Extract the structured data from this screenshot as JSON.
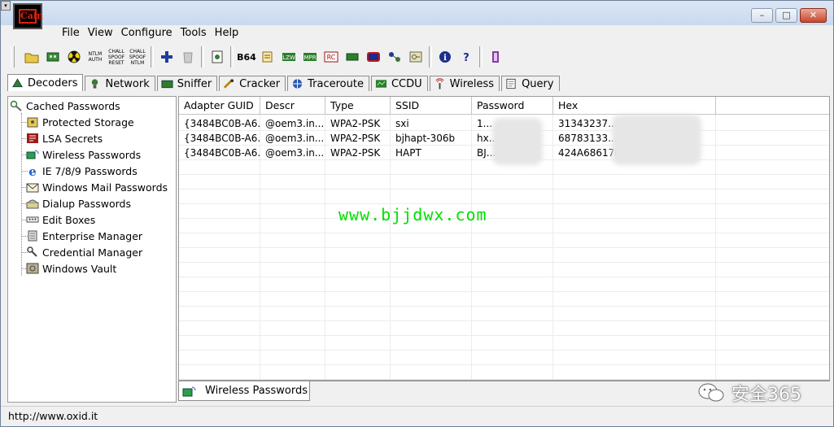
{
  "window": {
    "app_icon_text": "Cain",
    "buttons": {
      "minimize": "–",
      "maximize": "□",
      "close": "✕"
    }
  },
  "menu": [
    "File",
    "View",
    "Configure",
    "Tools",
    "Help"
  ],
  "toolbar": {
    "ntlm_auth": "NTLM AUTH",
    "chall_spoof_reset": "CHALL SPOOF RESET",
    "chall_spoof_ntlm": "CHALL SPOOF NTLM",
    "b64": "B64"
  },
  "tabs": [
    "Decoders",
    "Network",
    "Sniffer",
    "Cracker",
    "Traceroute",
    "CCDU",
    "Wireless",
    "Query"
  ],
  "tree": {
    "root": "Cached Passwords",
    "items": [
      "Protected Storage",
      "LSA Secrets",
      "Wireless Passwords",
      "IE 7/8/9 Passwords",
      "Windows Mail Passwords",
      "Dialup Passwords",
      "Edit Boxes",
      "Enterprise Manager",
      "Credential Manager",
      "Windows Vault"
    ]
  },
  "table": {
    "columns": [
      "Adapter GUID",
      "Descr",
      "Type",
      "SSID",
      "Password",
      "Hex"
    ],
    "rows": [
      [
        "{3484BC0B-A6...",
        "@oem3.in...",
        "WPA2-PSK",
        "sxi",
        "1...",
        "31343237..."
      ],
      [
        "{3484BC0B-A6...",
        "@oem3.in...",
        "WPA2-PSK",
        "bjhapt-306b",
        "hx...",
        "68783133..."
      ],
      [
        "{3484BC0B-A6...",
        "@oem3.in...",
        "WPA2-PSK",
        "HAPT",
        "BJ...",
        "424A686170..."
      ]
    ]
  },
  "watermark": "www.bjjdwx.com",
  "bottom_tab": "Wireless Passwords",
  "status": "http://www.oxid.it",
  "badge": "安全365"
}
